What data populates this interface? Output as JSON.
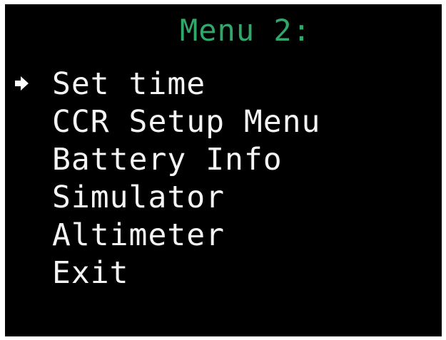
{
  "screen": {
    "title": "Menu 2:",
    "title_color": "#2fa86a",
    "text_color": "#f4f4f4",
    "background": "#000000"
  },
  "menu": {
    "cursor_icon": "arrow-right-icon",
    "selected_index": 0,
    "items": [
      {
        "label": "Set time"
      },
      {
        "label": "CCR Setup Menu"
      },
      {
        "label": "Battery Info"
      },
      {
        "label": "Simulator"
      },
      {
        "label": "Altimeter"
      },
      {
        "label": "Exit"
      }
    ]
  }
}
